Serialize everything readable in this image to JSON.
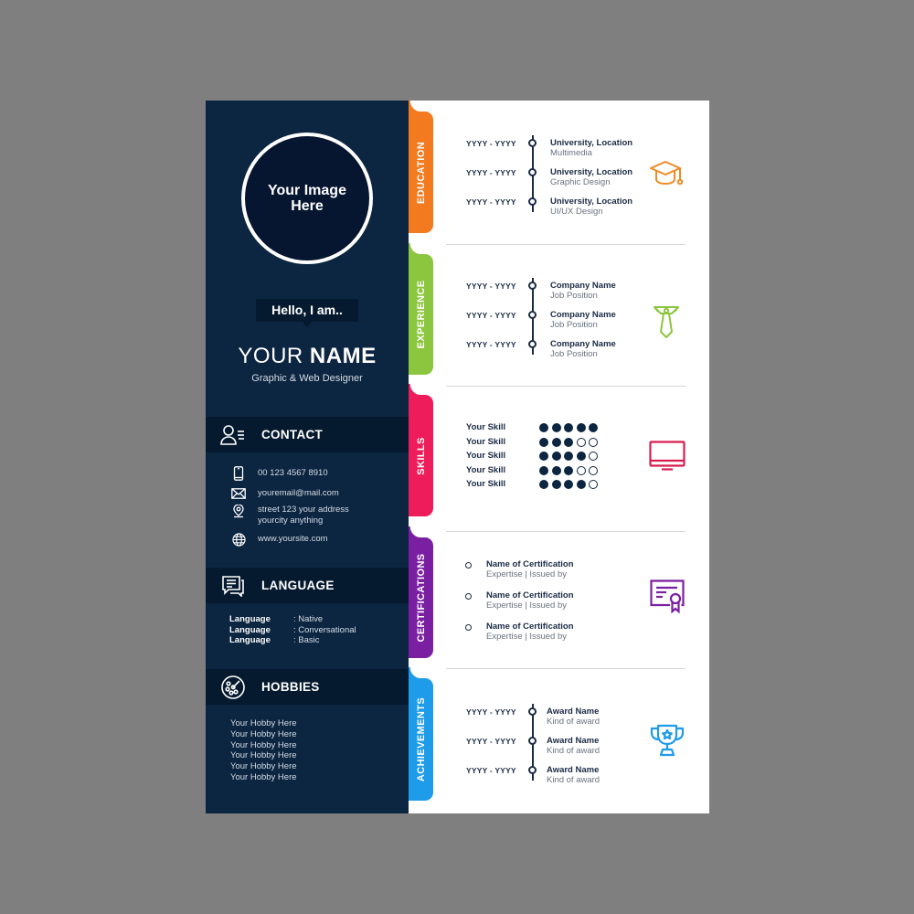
{
  "profile": {
    "photo_placeholder": "Your Image Here",
    "greeting": "Hello, I am..",
    "name_first": "YOUR",
    "name_last": "NAME",
    "role": "Graphic & Web Designer"
  },
  "contact": {
    "title": "CONTACT",
    "icon": "contact-card-icon",
    "items": [
      {
        "icon": "phone-icon",
        "lines": [
          "00 123 4567 8910"
        ]
      },
      {
        "icon": "email-icon",
        "lines": [
          "youremail@mail.com"
        ]
      },
      {
        "icon": "location-pin-icon",
        "lines": [
          "street 123 your address",
          "yourcity anything"
        ]
      },
      {
        "icon": "globe-icon",
        "lines": [
          "www.yoursite.com"
        ]
      }
    ]
  },
  "language": {
    "title": "LANGUAGE",
    "icon": "chat-bubbles-icon",
    "items": [
      {
        "name": "Language",
        "level": ": Native"
      },
      {
        "name": "Language",
        "level": ": Conversational"
      },
      {
        "name": "Language",
        "level": ": Basic"
      }
    ]
  },
  "hobbies": {
    "title": "HOBBIES",
    "icon": "palette-icon",
    "items": [
      "Your Hobby Here",
      "Your Hobby Here",
      "Your Hobby Here",
      "Your Hobby Here",
      "Your Hobby Here",
      "Your Hobby Here"
    ]
  },
  "colors": {
    "sidebar": "#0c2540",
    "sidebar_header": "#061a2f",
    "education": "#f47a1f",
    "experience": "#8cc63f",
    "skills": "#ee1c5a",
    "certifications": "#7a1fa2",
    "achievements": "#1e9be9"
  },
  "education": {
    "tab": "EDUCATION",
    "icon": "graduation-cap-icon",
    "items": [
      {
        "date": "YYYY - YYYY",
        "title": "University, Location",
        "sub": "Multimedia"
      },
      {
        "date": "YYYY - YYYY",
        "title": "University, Location",
        "sub": "Graphic Design"
      },
      {
        "date": "YYYY - YYYY",
        "title": "University, Location",
        "sub": "UI/UX Design"
      }
    ]
  },
  "experience": {
    "tab": "EXPERIENCE",
    "icon": "necktie-icon",
    "items": [
      {
        "date": "YYYY - YYYY",
        "title": "Company Name",
        "sub": "Job Position"
      },
      {
        "date": "YYYY - YYYY",
        "title": "Company Name",
        "sub": "Job Position"
      },
      {
        "date": "YYYY - YYYY",
        "title": "Company Name",
        "sub": "Job Position"
      }
    ]
  },
  "skills": {
    "tab": "SKILLS",
    "icon": "monitor-icon",
    "max": 5,
    "items": [
      {
        "name": "Your Skill",
        "rating": 5
      },
      {
        "name": "Your Skill",
        "rating": 3
      },
      {
        "name": "Your Skill",
        "rating": 4
      },
      {
        "name": "Your Skill",
        "rating": 3
      },
      {
        "name": "Your Skill",
        "rating": 4
      }
    ]
  },
  "certifications": {
    "tab": "CERTIFICATIONS",
    "icon": "certificate-icon",
    "items": [
      {
        "title": "Name of Certification",
        "sub": "Expertise | Issued by"
      },
      {
        "title": "Name of Certification",
        "sub": "Expertise | Issued by"
      },
      {
        "title": "Name of Certification",
        "sub": "Expertise | Issued by"
      }
    ]
  },
  "achievements": {
    "tab": "ACHIEVEMENTS",
    "icon": "trophy-icon",
    "items": [
      {
        "date": "YYYY - YYYY",
        "title": "Award Name",
        "sub": "Kind of award"
      },
      {
        "date": "YYYY - YYYY",
        "title": "Award Name",
        "sub": "Kind of award"
      },
      {
        "date": "YYYY - YYYY",
        "title": "Award Name",
        "sub": "Kind of award"
      }
    ]
  }
}
